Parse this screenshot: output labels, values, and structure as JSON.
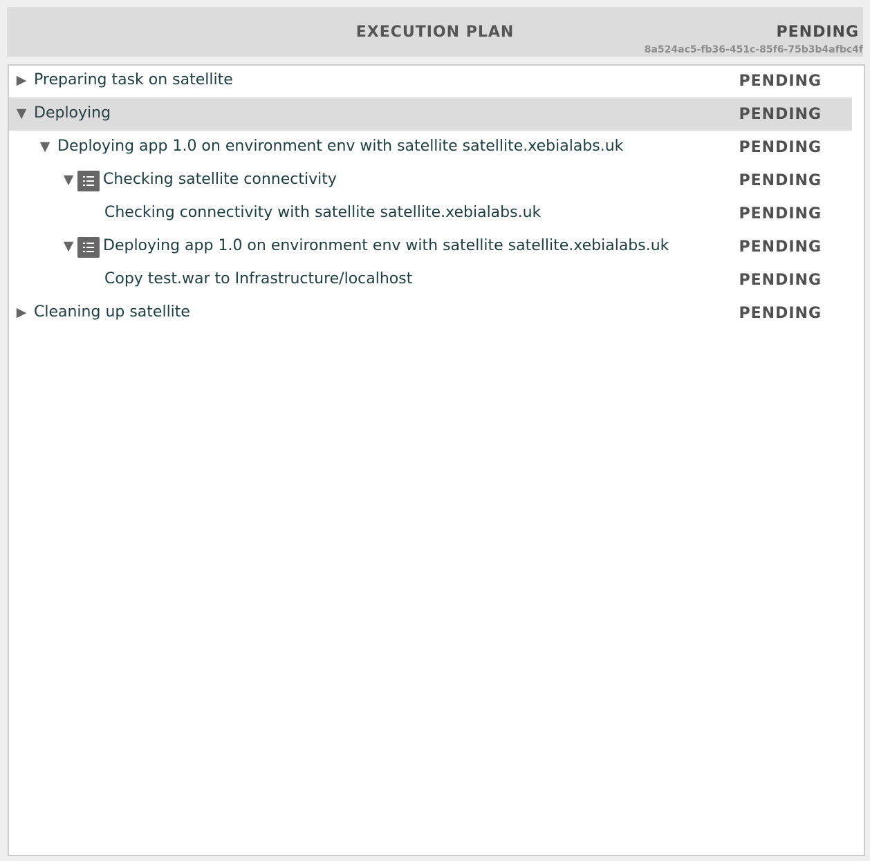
{
  "header": {
    "title": "EXECUTION PLAN",
    "status": "PENDING",
    "task_id": "8a524ac5-fb36-451c-85f6-75b3b4afbc4f"
  },
  "plan": {
    "rows": [
      {
        "label": "Preparing task on satellite",
        "state": "PENDING",
        "toggle": "collapsed",
        "has_icon": false
      },
      {
        "label": "Deploying",
        "state": "PENDING",
        "toggle": "expanded",
        "has_icon": false,
        "selected": true
      },
      {
        "label": "Deploying app 1.0 on environment env with satellite satellite.xebialabs.uk",
        "state": "PENDING",
        "toggle": "expanded",
        "has_icon": false
      },
      {
        "label": "Checking satellite connectivity",
        "state": "PENDING",
        "toggle": "expanded",
        "has_icon": true,
        "icon": "step-list-icon"
      },
      {
        "label": "Checking connectivity with satellite satellite.xebialabs.uk",
        "state": "PENDING",
        "toggle": "none",
        "has_icon": false
      },
      {
        "label": "Deploying app 1.0 on environment env with satellite satellite.xebialabs.uk",
        "state": "PENDING",
        "toggle": "expanded",
        "has_icon": true,
        "icon": "step-list-icon"
      },
      {
        "label": "Copy test.war to Infrastructure/localhost",
        "state": "PENDING",
        "toggle": "none",
        "has_icon": false
      },
      {
        "label": "Cleaning up satellite",
        "state": "PENDING",
        "toggle": "collapsed",
        "has_icon": false
      }
    ]
  },
  "icons": {
    "collapsed": "▶",
    "expanded": "▼"
  }
}
